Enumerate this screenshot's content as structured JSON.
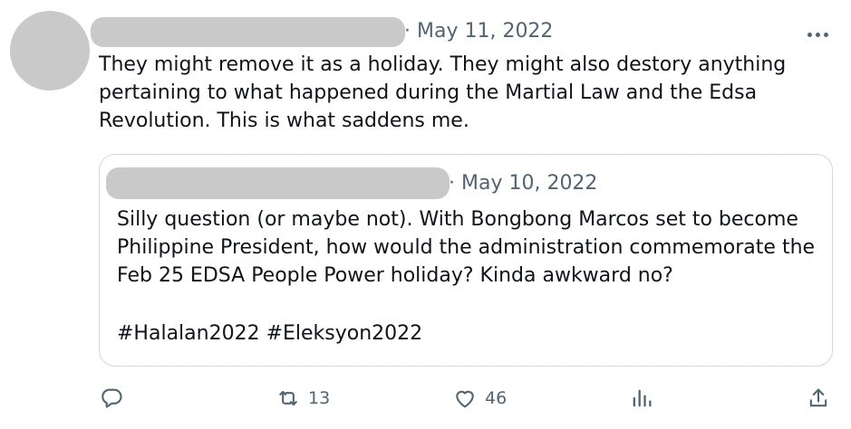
{
  "tweet": {
    "date": "· May 11, 2022",
    "text_lines": [
      "They might remove it as a holiday. They might also destory anything",
      "pertaining to what happened during the Martial Law and the Edsa",
      "Revolution. This is what saddens me."
    ]
  },
  "quoted": {
    "date": "· May 10, 2022",
    "text_lines": [
      "Silly question (or maybe not). With Bongbong Marcos set to become",
      "Philippine President, how would the administration commemorate the",
      "Feb 25 EDSA People Power holiday? Kinda awkward no?"
    ],
    "hashtags": "#Halalan2022 #Eleksyon2022"
  },
  "actions": {
    "reply_icon": "speech-bubble-icon",
    "retweet_icon": "retweet-arrows-icon",
    "retweet_count": "13",
    "like_icon": "heart-icon",
    "like_count": "46",
    "views_icon": "bar-chart-icon",
    "share_icon": "upload-arrow-icon"
  },
  "colors": {
    "text": "#0f1419",
    "secondary": "#536471",
    "border": "#cfd9de",
    "redaction": "#c9c9c9"
  }
}
